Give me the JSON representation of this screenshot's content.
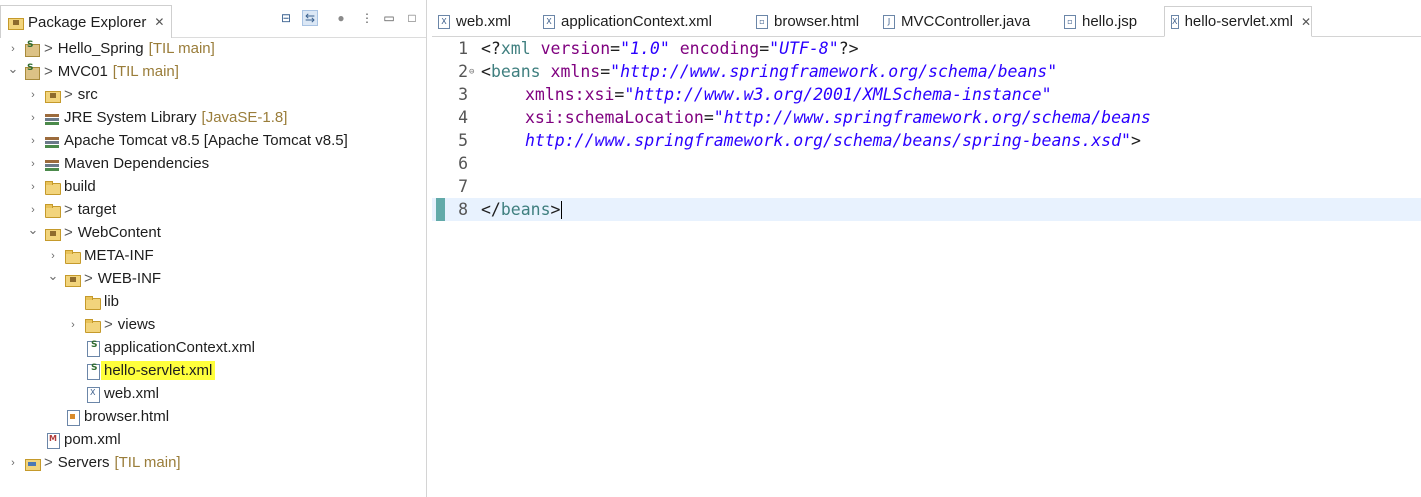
{
  "explorer": {
    "title": "Package Explorer",
    "close_glyph": "✕",
    "tree": [
      {
        "label": "Hello_Spring",
        "prefix": ">",
        "decoration": "[TIL main]",
        "expanded": false,
        "has_arrow": true,
        "level": 0,
        "icon": "project-icon"
      },
      {
        "label": "MVC01",
        "prefix": ">",
        "decoration": "[TIL main]",
        "expanded": true,
        "has_arrow": true,
        "level": 0,
        "icon": "project-icon"
      },
      {
        "label": "src",
        "prefix": ">",
        "decoration": "",
        "expanded": false,
        "has_arrow": true,
        "level": 1,
        "icon": "package-folder-icon"
      },
      {
        "label": "JRE System Library",
        "prefix": "",
        "decoration": "[JavaSE-1.8]",
        "expanded": false,
        "has_arrow": true,
        "level": 1,
        "icon": "library-icon"
      },
      {
        "label": "Apache Tomcat v8.5 [Apache Tomcat v8.5]",
        "prefix": "",
        "decoration": "",
        "expanded": false,
        "has_arrow": true,
        "level": 1,
        "icon": "library-icon"
      },
      {
        "label": "Maven Dependencies",
        "prefix": "",
        "decoration": "",
        "expanded": false,
        "has_arrow": true,
        "level": 1,
        "icon": "library-icon"
      },
      {
        "label": "build",
        "prefix": "",
        "decoration": "",
        "expanded": false,
        "has_arrow": true,
        "level": 1,
        "icon": "folder-icon"
      },
      {
        "label": "target",
        "prefix": ">",
        "decoration": "",
        "expanded": false,
        "has_arrow": true,
        "level": 1,
        "icon": "folder-icon"
      },
      {
        "label": "WebContent",
        "prefix": ">",
        "decoration": "",
        "expanded": true,
        "has_arrow": true,
        "level": 1,
        "icon": "package-folder-icon"
      },
      {
        "label": "META-INF",
        "prefix": "",
        "decoration": "",
        "expanded": false,
        "has_arrow": true,
        "level": 2,
        "icon": "folder-icon"
      },
      {
        "label": "WEB-INF",
        "prefix": ">",
        "decoration": "",
        "expanded": true,
        "has_arrow": true,
        "level": 2,
        "icon": "package-folder-icon"
      },
      {
        "label": "lib",
        "prefix": "",
        "decoration": "",
        "expanded": false,
        "has_arrow": false,
        "level": 3,
        "icon": "folder-icon"
      },
      {
        "label": "views",
        "prefix": ">",
        "decoration": "",
        "expanded": false,
        "has_arrow": true,
        "level": 3,
        "icon": "folder-icon"
      },
      {
        "label": "applicationContext.xml",
        "prefix": "",
        "decoration": "",
        "expanded": false,
        "has_arrow": false,
        "level": 3,
        "icon": "spring-file-icon"
      },
      {
        "label": "hello-servlet.xml",
        "prefix": "",
        "decoration": "",
        "expanded": false,
        "has_arrow": false,
        "level": 3,
        "icon": "spring-file-icon",
        "highlighted": true
      },
      {
        "label": "web.xml",
        "prefix": "",
        "decoration": "",
        "expanded": false,
        "has_arrow": false,
        "level": 3,
        "icon": "xml-file-icon"
      },
      {
        "label": "browser.html",
        "prefix": "",
        "decoration": "",
        "expanded": false,
        "has_arrow": false,
        "level": 2,
        "icon": "html-file-icon"
      },
      {
        "label": "pom.xml",
        "prefix": "",
        "decoration": "",
        "expanded": false,
        "has_arrow": false,
        "level": 1,
        "icon": "maven-file-icon"
      },
      {
        "label": "Servers",
        "prefix": ">",
        "decoration": "[TIL main]",
        "expanded": false,
        "has_arrow": true,
        "level": 0,
        "icon": "servers-folder-icon"
      }
    ]
  },
  "editor": {
    "tabs": [
      {
        "label": "web.xml",
        "icon": "xml-file-icon",
        "glyph": "X",
        "active": false
      },
      {
        "label": "applicationContext.xml",
        "icon": "xml-file-icon",
        "glyph": "X",
        "active": false
      },
      {
        "label": "browser.html",
        "icon": "html-file-icon",
        "glyph": "▫",
        "active": false
      },
      {
        "label": "MVCController.java",
        "icon": "java-file-icon",
        "glyph": "J",
        "active": false
      },
      {
        "label": "hello.jsp",
        "icon": "jsp-file-icon",
        "glyph": "▫",
        "active": false
      },
      {
        "label": "hello-servlet.xml",
        "icon": "xml-file-icon",
        "glyph": "X",
        "active": true
      }
    ],
    "close_glyph": "✕",
    "lines": [
      {
        "num": "1",
        "tokens": [
          [
            "pun",
            "<?"
          ],
          [
            "tag",
            "xml"
          ],
          [
            "pun",
            " "
          ],
          [
            "attr",
            "version"
          ],
          [
            "pun",
            "="
          ],
          [
            "val",
            "\"1.0\""
          ],
          [
            "pun",
            " "
          ],
          [
            "attr",
            "encoding"
          ],
          [
            "pun",
            "="
          ],
          [
            "val",
            "\"UTF-8\""
          ],
          [
            "pun",
            "?>"
          ]
        ]
      },
      {
        "num": "2",
        "fold": "⊖",
        "tokens": [
          [
            "pun",
            "<"
          ],
          [
            "tag",
            "beans"
          ],
          [
            "pun",
            " "
          ],
          [
            "attr",
            "xmlns"
          ],
          [
            "pun",
            "="
          ],
          [
            "val",
            "\"http://www.springframework.org/schema/beans\""
          ]
        ]
      },
      {
        "num": "3",
        "indent": true,
        "tokens": [
          [
            "attr",
            "xmlns:xsi"
          ],
          [
            "pun",
            "="
          ],
          [
            "val",
            "\"http://www.w3.org/2001/XMLSchema-instance\""
          ]
        ]
      },
      {
        "num": "4",
        "indent": true,
        "tokens": [
          [
            "attr",
            "xsi:schemaLocation"
          ],
          [
            "pun",
            "="
          ],
          [
            "val",
            "\"http://www.springframework.org/schema/beans"
          ]
        ]
      },
      {
        "num": "5",
        "indent": true,
        "tokens": [
          [
            "val",
            "http://www.springframework.org/schema/beans/spring-beans.xsd\""
          ],
          [
            "pun",
            ">"
          ]
        ]
      },
      {
        "num": "6",
        "tokens": []
      },
      {
        "num": "7",
        "tokens": []
      },
      {
        "num": "8",
        "current": true,
        "marker": true,
        "tokens": [
          [
            "pun",
            "</"
          ],
          [
            "tag",
            "beans"
          ],
          [
            "pun",
            ">"
          ]
        ]
      }
    ]
  },
  "colors": {
    "highlight": "#ffff3c",
    "current_line": "#e8f2fe",
    "tag": "#3f7f7f",
    "attribute": "#7f007f",
    "value": "#2a00ff",
    "decoration": "#9a7d3a"
  }
}
